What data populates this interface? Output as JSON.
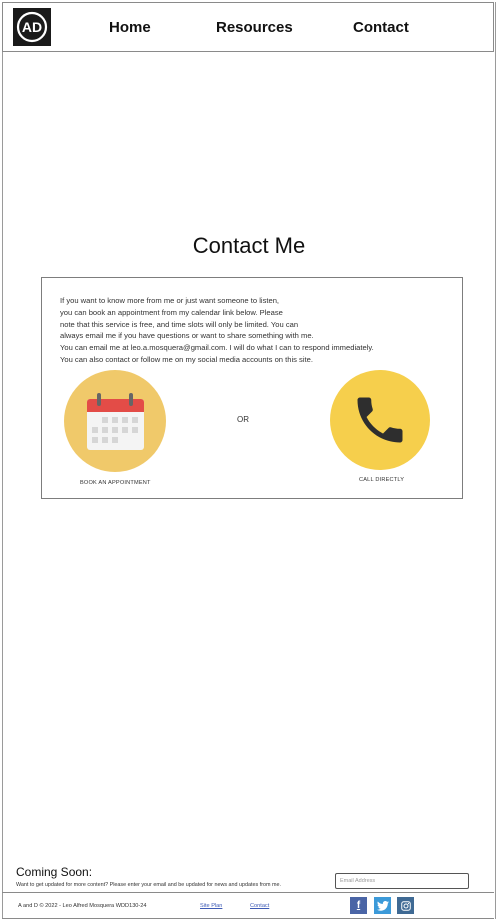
{
  "header": {
    "logo_text": "AD",
    "nav": [
      "Home",
      "Resources",
      "Contact"
    ]
  },
  "main": {
    "title": "Contact Me",
    "paragraph": [
      "If you want to know more from me or just want someone to listen,",
      "you can book an appointment from my calendar link below. Please",
      "note that this service is free, and time slots will only be limited. You can",
      "always email me if you have questions or want to share something with me.",
      "You can email me at leo.a.mosquera@gmail.com. I will do what I can to respond immediately.",
      "You can also contact or follow me on my social media accounts on this site."
    ],
    "book_label": "BOOK AN APPOINTMENT",
    "or_label": "OR",
    "call_label": "CALL DIRECTLY"
  },
  "newsletter": {
    "heading": "Coming Soon:",
    "subtext": "Want to get updated for more content? Please enter your email and be updated for news and updates from me.",
    "email_placeholder": "Email Address"
  },
  "footer": {
    "copyright": "A and D © 2022 - Leo Alfred Mosquera WDD130-24",
    "site_plan_label": "Site Plan",
    "contact_label": "Contact",
    "social_icons": [
      "facebook-icon",
      "twitter-icon",
      "instagram-icon"
    ]
  },
  "colors": {
    "calendar_circle": "#f0c96a",
    "phone_circle": "#f6cf4c",
    "calendar_header": "#e34c47",
    "logo_bg": "#1a1a1a",
    "facebook": "#4a65a6",
    "twitter": "#3c9ad9",
    "instagram": "#3f6a94"
  }
}
